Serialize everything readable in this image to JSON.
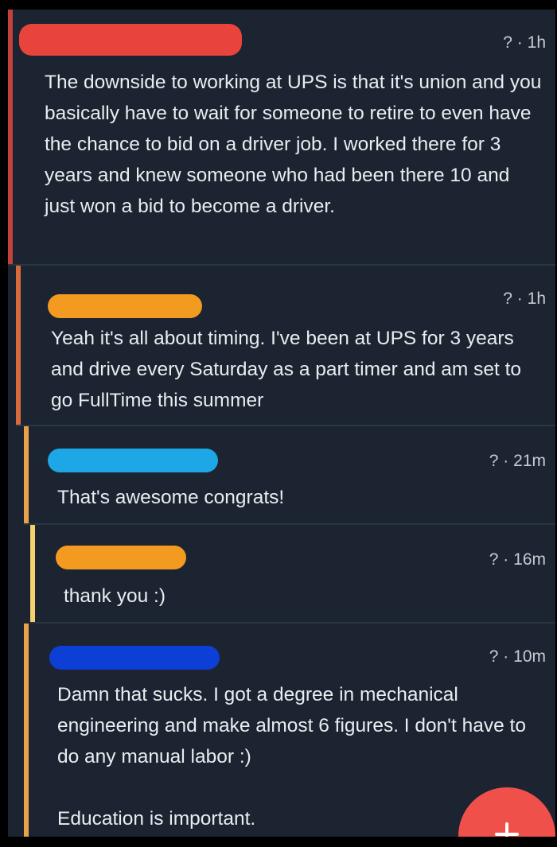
{
  "thread": {
    "comments": [
      {
        "meta": "? · 1h",
        "paragraphs": [
          "The downside to working at UPS is that it's union and you basically have to wait for someone to retire to even have the chance to bid on a driver job. I worked there for 3 years and knew someone who had been there 10 and just won a bid to become a driver."
        ],
        "line_color": "#c2413b",
        "blob_color": "#e8443c"
      },
      {
        "meta": "? · 1h",
        "paragraphs": [
          "Yeah it's all about timing. I've been at UPS for 3 years and drive every Saturday as a part timer and am set to go FullTime this summer"
        ],
        "line_color": "#d86a3c",
        "blob_color": "#f39a21"
      },
      {
        "meta": "? · 21m",
        "paragraphs": [
          "That's awesome congrats!"
        ],
        "line_color": "#e8a34a",
        "blob_color": "#1ea7e6"
      },
      {
        "meta": "? · 16m",
        "paragraphs": [
          "thank you :)"
        ],
        "line_color": "#f4d070",
        "blob_color": "#f39a21"
      },
      {
        "meta": "? · 10m",
        "paragraphs": [
          "Damn that sucks. I got a degree in mechanical engineering and make almost 6 figures. I don't have to do any manual labor :)",
          "Education is important."
        ],
        "line_color": "#e8a34a",
        "blob_color": "#0d3fd6"
      }
    ]
  },
  "fab": {
    "icon": "plus-icon",
    "color": "#f0504a"
  }
}
